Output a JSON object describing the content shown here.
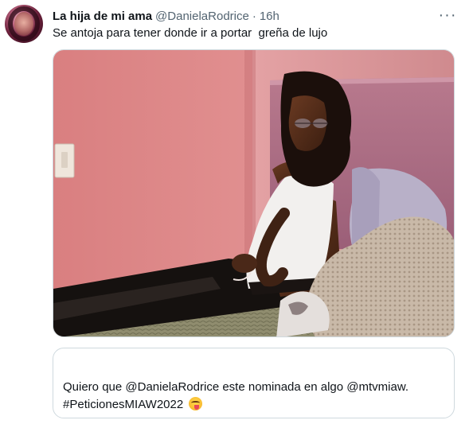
{
  "tweet": {
    "display_name": "La hija de mi ama",
    "handle": "@DanielaRodrice",
    "separator": "·",
    "time": "16h",
    "more_icon": "···",
    "text": "Se antoja para tener donde ir a portar  greña de lujo"
  },
  "media": {
    "icon": "photo-icon"
  },
  "quote": {
    "text": "Quiero que @DanielaRodrice este nominada en algo @mtvmiaw.",
    "hashtag": "#PeticionesMIAW2022",
    "emoji_icon": "face-savoring-food-icon"
  }
}
